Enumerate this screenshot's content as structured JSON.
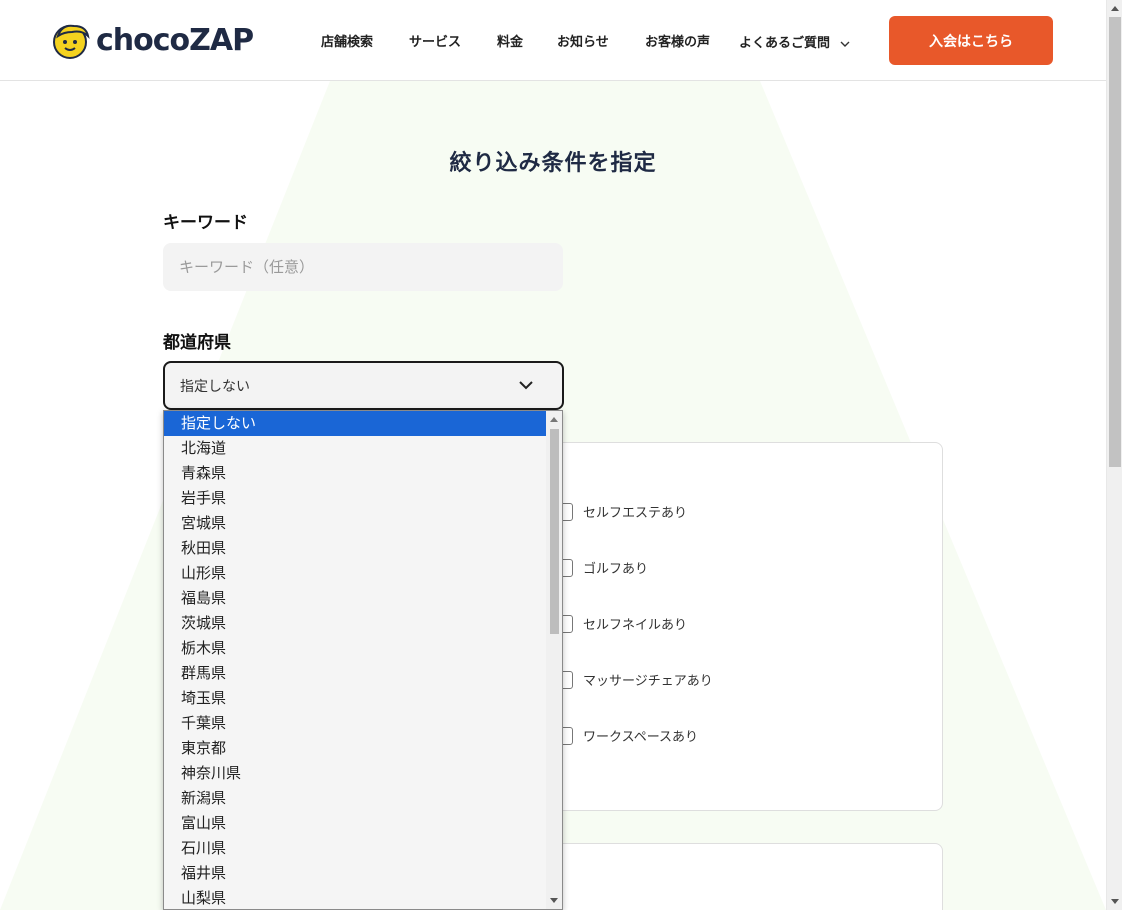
{
  "header": {
    "logo_text": "chocoZAP",
    "nav": [
      {
        "label": "店舗検索"
      },
      {
        "label": "サービス"
      },
      {
        "label": "料金"
      },
      {
        "label": "お知らせ"
      },
      {
        "label": "お客様の声"
      },
      {
        "label": "よくあるご質問"
      }
    ],
    "join_label": "入会はこちら"
  },
  "colors": {
    "accent": "#e8582a",
    "select_highlight": "#1a66d6",
    "title_navy": "#1f2a44",
    "logo_yellow": "#f4d21f"
  },
  "main": {
    "title": "絞り込み条件を指定",
    "keyword_label": "キーワード",
    "keyword_placeholder": "キーワード（任意）",
    "keyword_value": "",
    "prefecture_label": "都道府県",
    "prefecture_selected": "指定しない"
  },
  "options": [
    {
      "label": "セルフエステあり",
      "checked": false
    },
    {
      "label": "ゴルフあり",
      "checked": false
    },
    {
      "label": "セルフネイルあり",
      "checked": false
    },
    {
      "label": "マッサージチェアあり",
      "checked": false
    },
    {
      "label": "ワークスペースあり",
      "checked": false
    }
  ],
  "dropdown": {
    "items": [
      "指定しない",
      "北海道",
      "青森県",
      "岩手県",
      "宮城県",
      "秋田県",
      "山形県",
      "福島県",
      "茨城県",
      "栃木県",
      "群馬県",
      "埼玉県",
      "千葉県",
      "東京都",
      "神奈川県",
      "新潟県",
      "富山県",
      "石川県",
      "福井県",
      "山梨県"
    ],
    "selected_index": 0
  }
}
